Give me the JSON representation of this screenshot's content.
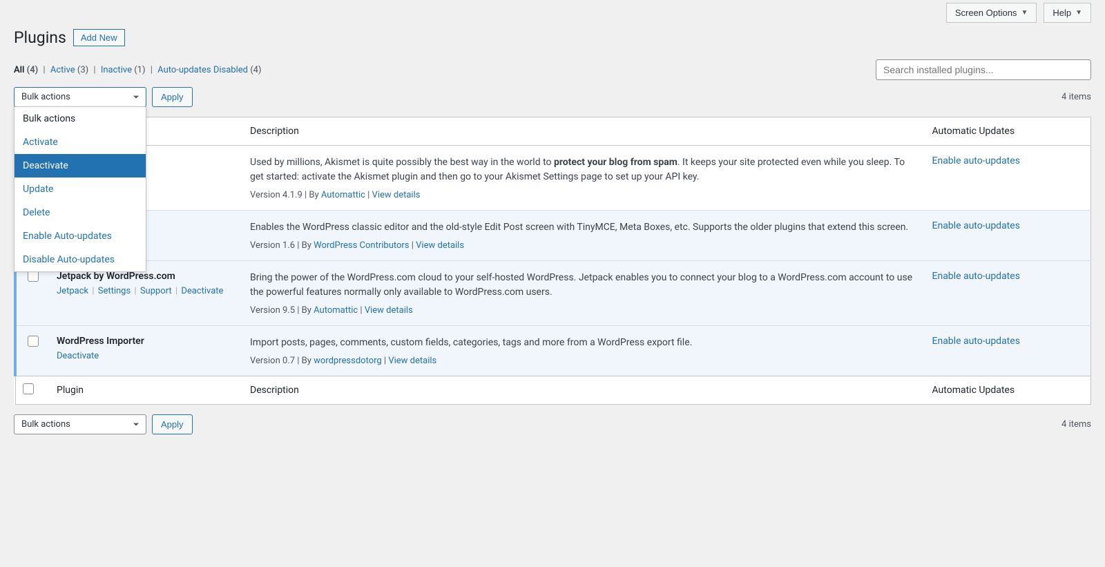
{
  "top_buttons": {
    "screen_options": "Screen Options",
    "help": "Help"
  },
  "header": {
    "title": "Plugins",
    "add_new": "Add New"
  },
  "filters": {
    "all_label": "All",
    "all_count": "(4)",
    "active_label": "Active",
    "active_count": "(3)",
    "inactive_label": "Inactive",
    "inactive_count": "(1)",
    "auto_disabled_label": "Auto-updates Disabled",
    "auto_disabled_count": "(4)"
  },
  "search": {
    "placeholder": "Search installed plugins..."
  },
  "bulk": {
    "label": "Bulk actions",
    "apply": "Apply",
    "options": [
      "Bulk actions",
      "Activate",
      "Deactivate",
      "Update",
      "Delete",
      "Enable Auto-updates",
      "Disable Auto-updates"
    ]
  },
  "items_count": "4 items",
  "columns": {
    "plugin": "Plugin",
    "description": "Description",
    "auto_updates": "Automatic Updates"
  },
  "plugins": [
    {
      "active": false,
      "desc_prefix": "Used by millions, Akismet is quite possibly the best way in the world to ",
      "desc_bold": "protect your blog from spam",
      "desc_suffix": ". It keeps your site protected even while you sleep. To get started: activate the Akismet plugin and then go to your Akismet Settings page to set up your API key.",
      "version_by": "Version 4.1.9 | By ",
      "author": "Automattic",
      "view_details": "View details",
      "auto": "Enable auto-updates"
    },
    {
      "active": true,
      "desc": "Enables the WordPress classic editor and the old-style Edit Post screen with TinyMCE, Meta Boxes, etc. Supports the older plugins that extend this screen.",
      "version_by": "Version 1.6 | By ",
      "author": "WordPress Contributors",
      "view_details": "View details",
      "auto": "Enable auto-updates"
    },
    {
      "active": true,
      "title": "Jetpack by WordPress.com",
      "actions": [
        "Jetpack",
        "Settings",
        "Support",
        "Deactivate"
      ],
      "desc": "Bring the power of the WordPress.com cloud to your self-hosted WordPress. Jetpack enables you to connect your blog to a WordPress.com account to use the powerful features normally only available to WordPress.com users.",
      "version_by": "Version 9.5 | By ",
      "author": "Automattic",
      "view_details": "View details",
      "auto": "Enable auto-updates"
    },
    {
      "active": true,
      "title": "WordPress Importer",
      "actions": [
        "Deactivate"
      ],
      "desc": "Import posts, pages, comments, custom fields, categories, tags and more from a WordPress export file.",
      "version_by": "Version 0.7 | By ",
      "author": "wordpressdotorg",
      "view_details": "View details",
      "auto": "Enable auto-updates"
    }
  ]
}
